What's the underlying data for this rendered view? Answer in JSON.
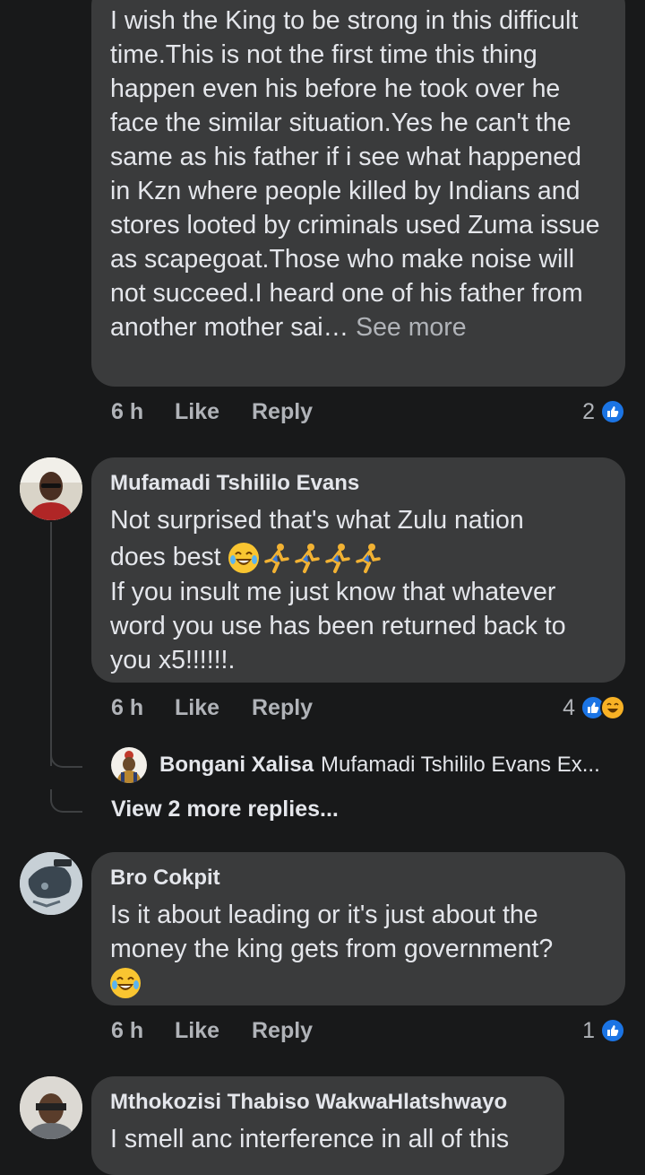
{
  "comments": [
    {
      "author": "",
      "text": "I wish the King to be strong in this difficult time.This is not the first time this thing happen even his before he took over he face the similar situation.Yes he can't the same as his father if i see what happened in Kzn where people killed by Indians and stores looted by criminals used Zuma issue as scapegoat.Those who make noise will not succeed.I heard one of his father from another mother sai…",
      "see_more": "See more",
      "time": "6 h",
      "like": "Like",
      "reply": "Reply",
      "reaction_count": "2",
      "reactions": [
        "like-icon"
      ]
    },
    {
      "author": "Mufamadi Tshililo Evans",
      "text_line1": "Not surprised that's what Zulu nation",
      "text_line2": "does best",
      "text_rest": "If you insult me just know that whatever word you use has been returned back to you x5!!!!!!.",
      "emojis": [
        "laughing-tears-emoji",
        "runner-emoji",
        "runner-emoji",
        "runner-emoji",
        "runner-emoji"
      ],
      "time": "6 h",
      "like": "Like",
      "reply": "Reply",
      "reaction_count": "4",
      "reactions": [
        "like-icon",
        "haha-icon"
      ],
      "reply_preview": {
        "author": "Bongani Xalisa",
        "text": "Mufamadi Tshililo Evans Ex..."
      },
      "view_more": "View 2 more replies..."
    },
    {
      "author": "Bro Cokpit",
      "text": "Is it about leading or it's just about the money the king gets from government?",
      "emojis": [
        "laughing-tears-emoji"
      ],
      "time": "6 h",
      "like": "Like",
      "reply": "Reply",
      "reaction_count": "1",
      "reactions": [
        "like-icon"
      ]
    },
    {
      "author": "Mthokozisi Thabiso WakwaHlatshwayo",
      "text": "I smell anc interference in all of this"
    }
  ],
  "colors": {
    "background": "#18191a",
    "bubble": "#3a3b3c",
    "text": "#e4e6eb",
    "secondary_text": "#b0b3b8",
    "like_blue": "#1b74e4",
    "haha_yellow": "#f7b125"
  }
}
